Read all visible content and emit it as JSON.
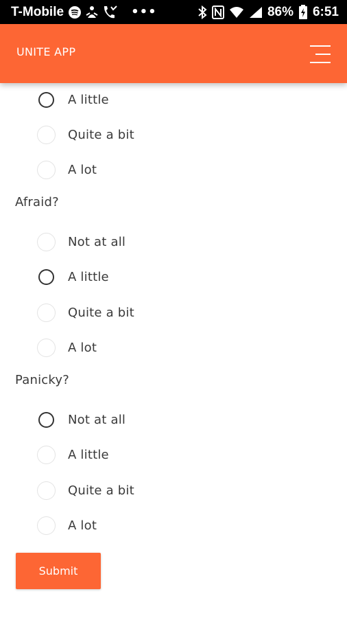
{
  "status_bar": {
    "carrier": "T-Mobile",
    "more": "•••",
    "battery": "86%",
    "time": "6:51"
  },
  "app_bar": {
    "title": "UNITE APP"
  },
  "form": {
    "partial_question": {
      "options": [
        "A little",
        "Quite a bit",
        "A lot"
      ]
    },
    "questions": [
      {
        "label": "Afraid?",
        "options": [
          "Not at all",
          "A little",
          "Quite a bit",
          "A lot"
        ]
      },
      {
        "label": "Panicky?",
        "options": [
          "Not at all",
          "A little",
          "Quite a bit",
          "A lot"
        ]
      }
    ],
    "submit_label": "Submit"
  },
  "colors": {
    "accent": "#fd6634",
    "status_bar": "#000000",
    "text": "#3a3a3a"
  }
}
